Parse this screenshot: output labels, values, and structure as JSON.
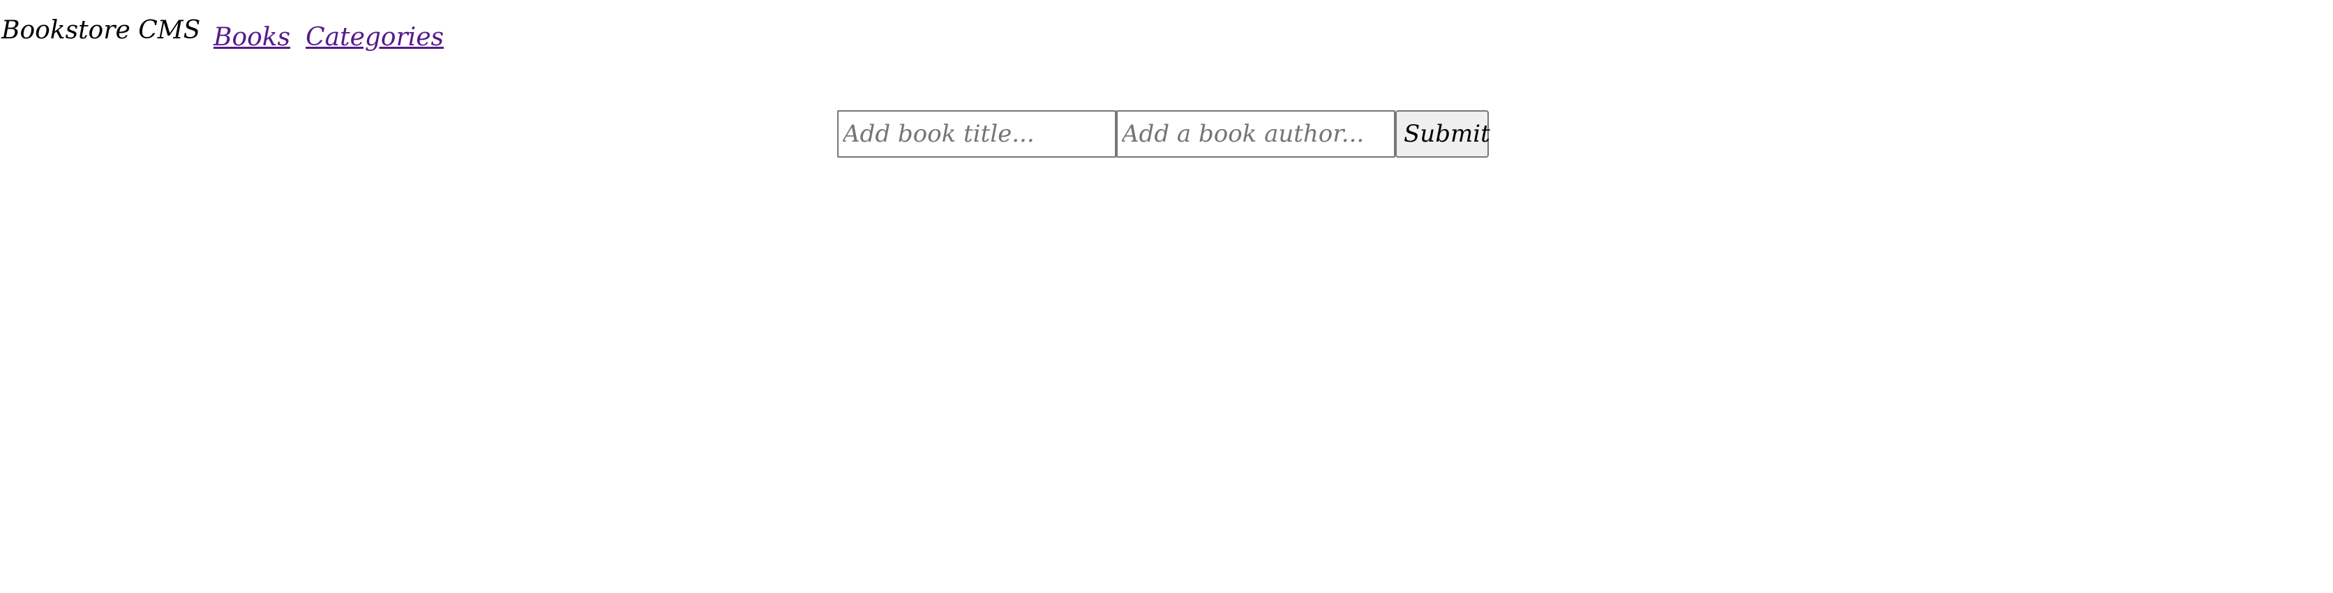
{
  "header": {
    "brand": "Bookstore CMS",
    "nav": [
      {
        "label": "Books"
      },
      {
        "label": "Categories"
      }
    ]
  },
  "form": {
    "title_input": {
      "value": "",
      "placeholder": "Add book title..."
    },
    "author_input": {
      "value": "",
      "placeholder": "Add a book author..."
    },
    "submit_label": "Submit"
  },
  "colors": {
    "link": "#551a8b",
    "text": "#000000",
    "background": "#ffffff",
    "button_bg": "#efefef",
    "input_border": "#767676"
  }
}
